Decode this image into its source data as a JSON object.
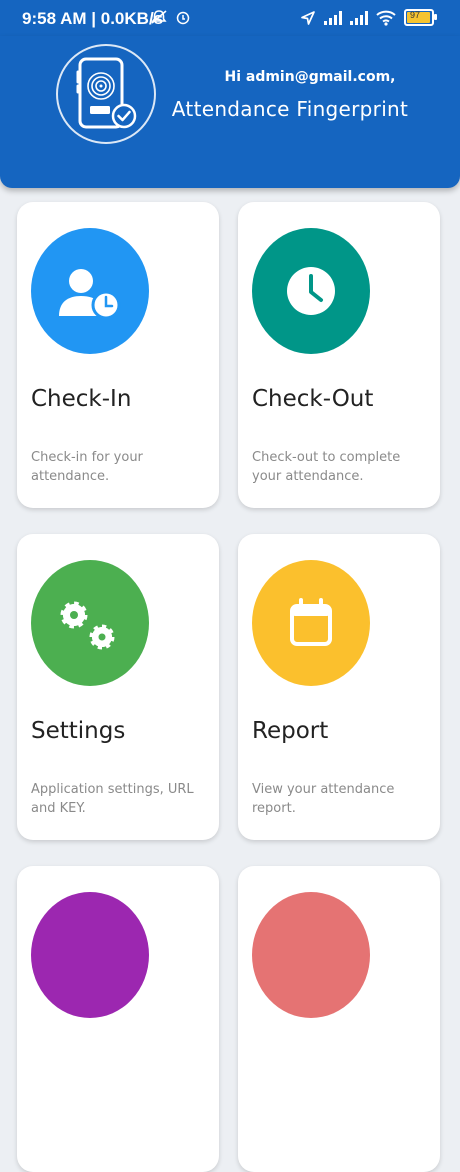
{
  "status_bar": {
    "time": "9:58 AM | 0.0KB/s",
    "battery_level": "97",
    "icons": [
      "mute-icon",
      "sync-icon",
      "location-icon",
      "signal-icon",
      "signal-icon",
      "wifi-icon",
      "battery-icon"
    ]
  },
  "header": {
    "greeting": "Hi admin@gmail.com,",
    "title": "Attendance Fingerprint",
    "background_color": "#1565c0"
  },
  "menu": [
    {
      "title": "Check-In",
      "description": "Check-in for your attendance.",
      "color": "#2196f3",
      "icon": "user-clock-icon"
    },
    {
      "title": "Check-Out",
      "description": "Check-out to complete your attendance.",
      "color": "#009688",
      "icon": "clock-icon"
    },
    {
      "title": "Settings",
      "description": "Application settings, URL and KEY.",
      "color": "#4caf50",
      "icon": "gears-icon"
    },
    {
      "title": "Report",
      "description": "View your attendance report.",
      "color": "#fbc02d",
      "icon": "calendar-icon"
    },
    {
      "color": "#9c27b0"
    },
    {
      "color": "#e57373"
    }
  ]
}
